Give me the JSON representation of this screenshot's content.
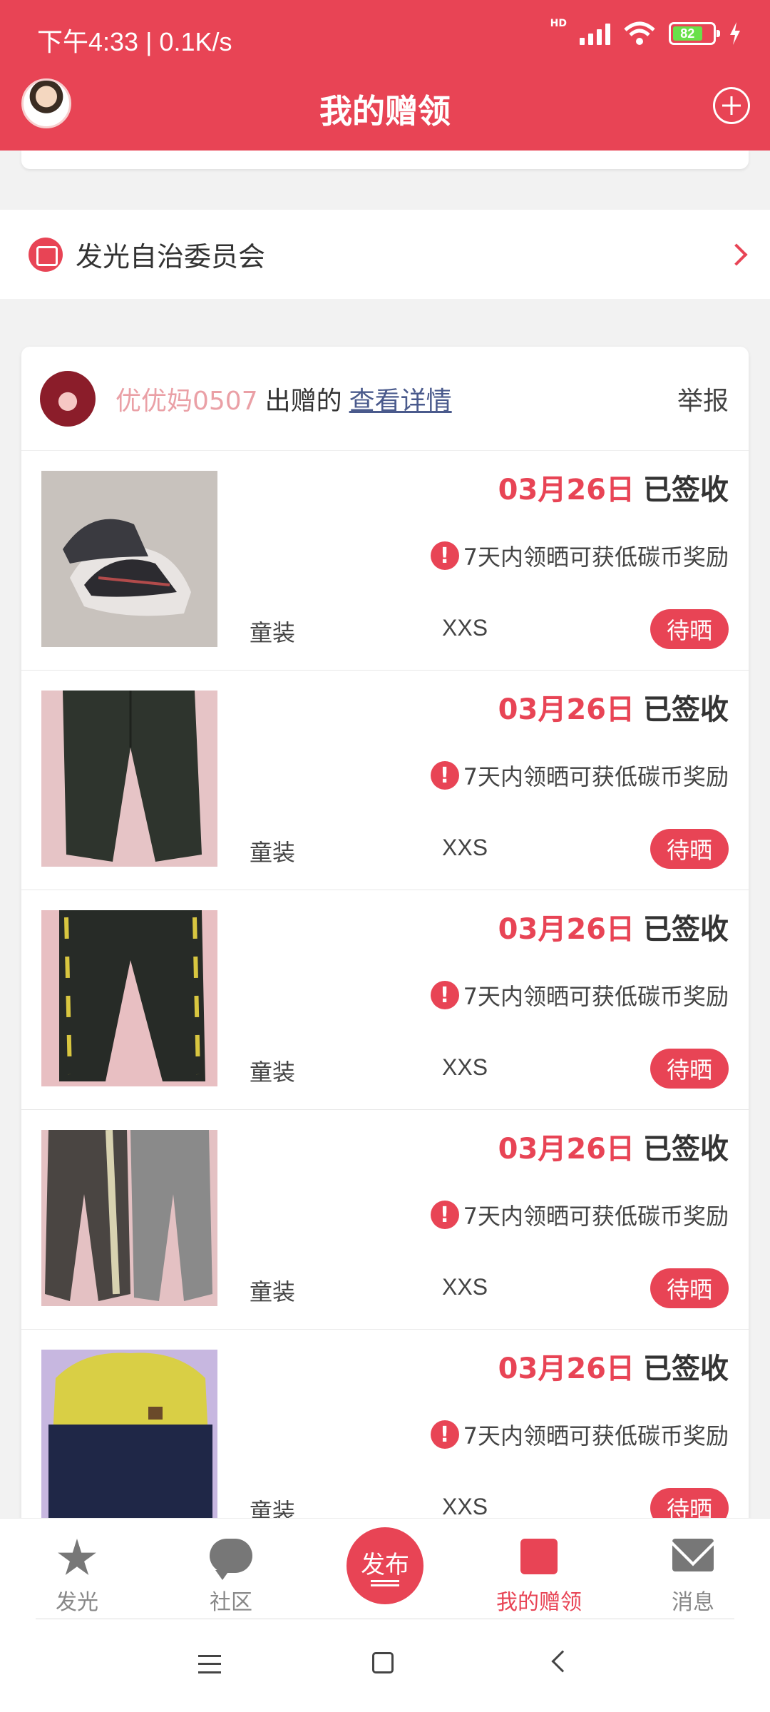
{
  "status_bar": {
    "time": "下午4:33 | 0.1K/s",
    "network": "HD",
    "battery": "82"
  },
  "header": {
    "title": "我的赠领"
  },
  "org": {
    "name": "发光自治委员会"
  },
  "card": {
    "giver": "优优妈0507",
    "give_text": "出赠的",
    "detail_link": "查看详情",
    "report": "举报",
    "items": [
      {
        "date": "03月26日",
        "status": "已签收",
        "reward": "7天内领晒可获低碳币奖励",
        "category": "童装",
        "size": "XXS",
        "action": "待晒",
        "image": "sneakers-photo"
      },
      {
        "date": "03月26日",
        "status": "已签收",
        "reward": "7天内领晒可获低碳币奖励",
        "category": "童装",
        "size": "XXS",
        "action": "待晒",
        "image": "dark-pants-photo"
      },
      {
        "date": "03月26日",
        "status": "已签收",
        "reward": "7天内领晒可获低碳币奖励",
        "category": "童装",
        "size": "XXS",
        "action": "待晒",
        "image": "striped-pants-photo"
      },
      {
        "date": "03月26日",
        "status": "已签收",
        "reward": "7天内领晒可获低碳币奖励",
        "category": "童装",
        "size": "XXS",
        "action": "待晒",
        "image": "two-pants-photo"
      },
      {
        "date": "03月26日",
        "status": "已签收",
        "reward": "7天内领晒可获低碳币奖励",
        "category": "童装",
        "size": "XXS",
        "action": "待晒",
        "image": "yellow-jacket-photo"
      }
    ]
  },
  "bottom_nav": {
    "items": [
      {
        "label": "发光",
        "icon": "star-icon"
      },
      {
        "label": "社区",
        "icon": "chat-bubble-icon"
      },
      {
        "label": "发布",
        "icon": "publish-icon"
      },
      {
        "label": "我的赠领",
        "icon": "gift-box-icon"
      },
      {
        "label": "消息",
        "icon": "mail-icon"
      }
    ],
    "active": "我的赠领",
    "accent": "#e84455"
  }
}
